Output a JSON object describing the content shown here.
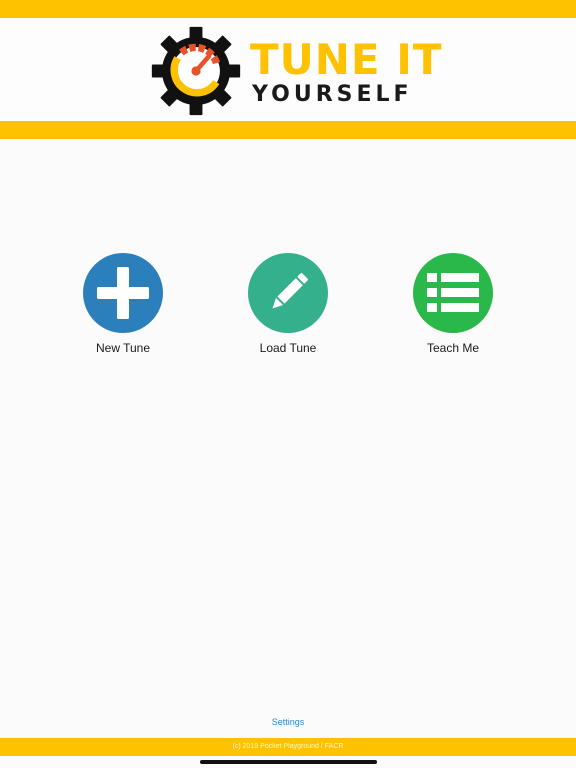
{
  "header": {
    "logo_line1": "TUNE IT",
    "logo_line2": "YOURSELF"
  },
  "actions": [
    {
      "label": "New Tune",
      "icon": "plus-icon",
      "color": "#2b7fbb"
    },
    {
      "label": "Load Tune",
      "icon": "pencil-icon",
      "color": "#34b08d"
    },
    {
      "label": "Teach Me",
      "icon": "list-icon",
      "color": "#2bb84a"
    }
  ],
  "footer": {
    "settings_label": "Settings",
    "copyright": "(c) 2019 Pocket Playground / FACR"
  },
  "colors": {
    "brand_yellow": "#fec200",
    "gauge_red": "#e8522a",
    "link_blue": "#2f86d6"
  }
}
